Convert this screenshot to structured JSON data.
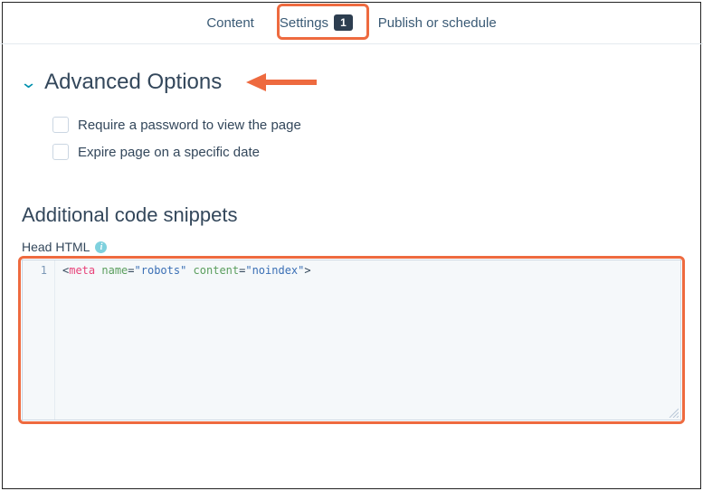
{
  "tabs": {
    "content": "Content",
    "settings": "Settings",
    "settings_badge": "1",
    "publish": "Publish or schedule"
  },
  "advanced": {
    "title": "Advanced Options",
    "require_password": "Require a password to view the page",
    "expire_page": "Expire page on a specific date"
  },
  "snippets": {
    "title": "Additional code snippets",
    "head_label": "Head HTML",
    "line_no": "1",
    "tag": "meta",
    "attr1": "name",
    "val1": "\"robots\"",
    "attr2": "content",
    "val2": "\"noindex\""
  }
}
